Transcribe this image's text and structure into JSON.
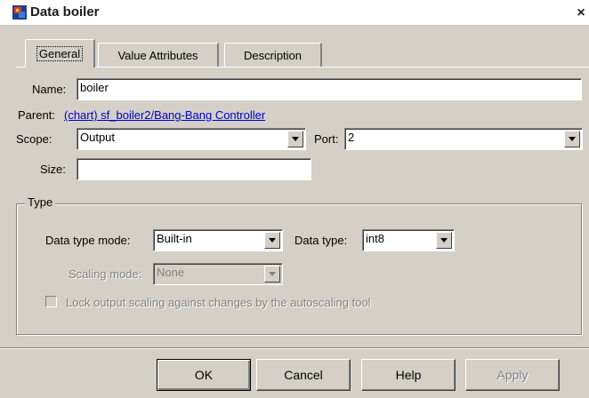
{
  "window": {
    "title": "Data boiler",
    "close_glyph": "×"
  },
  "tabs": [
    {
      "label": "General",
      "selected": true
    },
    {
      "label": "Value Attributes",
      "selected": false
    },
    {
      "label": "Description",
      "selected": false
    }
  ],
  "general": {
    "name_label": "Name:",
    "name_value": "boiler",
    "parent_label": "Parent:",
    "parent_link": "(chart) sf_boiler2/Bang-Bang Controller",
    "scope_label": "Scope:",
    "scope_value": "Output",
    "port_label": "Port:",
    "port_value": "2",
    "size_label": "Size:",
    "size_value": ""
  },
  "type_group": {
    "label": "Type",
    "data_type_mode_label": "Data type mode:",
    "data_type_mode_value": "Built-in",
    "data_type_label": "Data type:",
    "data_type_value": "int8",
    "scaling_mode_label": "Scaling mode:",
    "scaling_mode_value": "None",
    "lock_label": "Lock output scaling against changes by the autoscaling tool",
    "lock_checked": false
  },
  "buttons": {
    "ok": "OK",
    "cancel": "Cancel",
    "help": "Help",
    "apply": "Apply"
  },
  "icons": {
    "app": "stateflow-data-icon",
    "dropdown": "chevron-down-icon",
    "close": "close-icon"
  },
  "colors": {
    "dialog_bg": "#d4d0c8",
    "link": "#0000cc"
  }
}
